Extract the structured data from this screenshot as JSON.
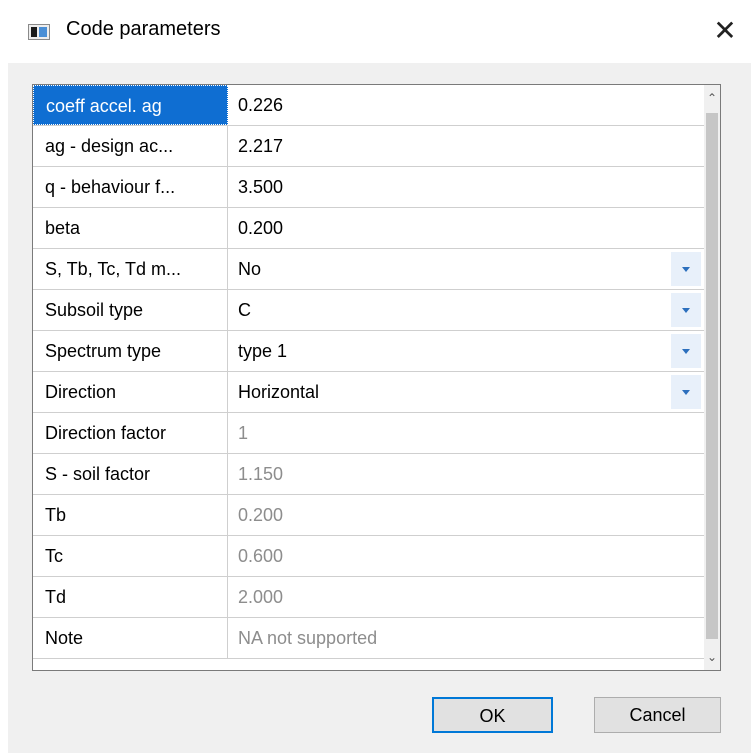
{
  "window": {
    "title": "Code parameters",
    "close_symbol": "✕",
    "icon": "app-window-icon"
  },
  "grid": {
    "rows": [
      {
        "label": "coeff accel. ag",
        "value": "0.226",
        "selected": true,
        "dropdown": false,
        "readonly": false
      },
      {
        "label": "ag - design ac...",
        "value": "2.217",
        "dropdown": false,
        "readonly": false
      },
      {
        "label": "q - behaviour f...",
        "value": "3.500",
        "dropdown": false,
        "readonly": false
      },
      {
        "label": "beta",
        "value": "0.200",
        "dropdown": false,
        "readonly": false
      },
      {
        "label": "S, Tb, Tc, Td m...",
        "value": "No",
        "dropdown": true,
        "readonly": false
      },
      {
        "label": "Subsoil type",
        "value": "C",
        "dropdown": true,
        "readonly": false
      },
      {
        "label": "Spectrum type",
        "value": "type 1",
        "dropdown": true,
        "readonly": false
      },
      {
        "label": "Direction",
        "value": "Horizontal",
        "dropdown": true,
        "readonly": false
      },
      {
        "label": "Direction factor",
        "value": "1",
        "dropdown": false,
        "readonly": true
      },
      {
        "label": "S - soil factor",
        "value": "1.150",
        "dropdown": false,
        "readonly": true
      },
      {
        "label": "Tb",
        "value": "0.200",
        "dropdown": false,
        "readonly": true
      },
      {
        "label": "Tc",
        "value": "0.600",
        "dropdown": false,
        "readonly": true
      },
      {
        "label": "Td",
        "value": "2.000",
        "dropdown": false,
        "readonly": true
      },
      {
        "label": "Note",
        "value": "NA not supported",
        "dropdown": false,
        "readonly": true
      }
    ],
    "scroll_up_glyph": "⌃",
    "scroll_down_glyph": "⌄"
  },
  "buttons": {
    "ok": "OK",
    "cancel": "Cancel"
  },
  "colors": {
    "selection": "#0f6ed2",
    "dropdown_arrow": "#2c6fbd",
    "readonly_text": "#8d8d8d",
    "ok_border": "#0078d7"
  }
}
